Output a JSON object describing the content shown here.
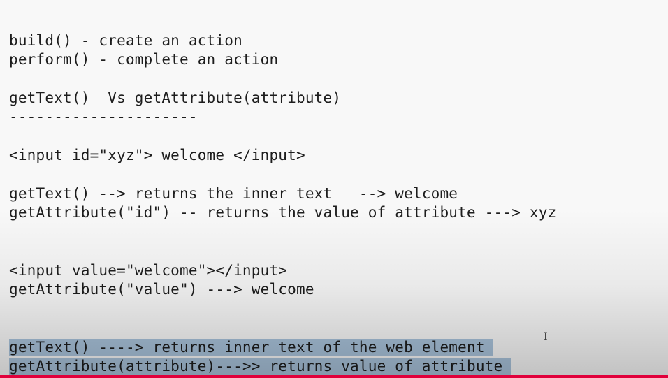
{
  "text_lines": [
    "build() - create an action",
    "perform() - complete an action",
    "getText()  Vs getAttribute(attribute)",
    "---------------------",
    "<input id=\"xyz\"> welcome </input>",
    "getText() --> returns the inner text   --> welcome",
    "getAttribute(\"id\") -- returns the value of attribute ---> xyz",
    "<input value=\"welcome\"></input>",
    "getAttribute(\"value\") ---> welcome",
    "getText() ----> returns inner text of the web element",
    "getAttribute(attribute)--->> returns value of attribute"
  ],
  "cursor_glyph": "I",
  "colors": {
    "selection": "#a9c3db",
    "progress_bar": "#e1003b",
    "text": "#1d1d1d"
  }
}
